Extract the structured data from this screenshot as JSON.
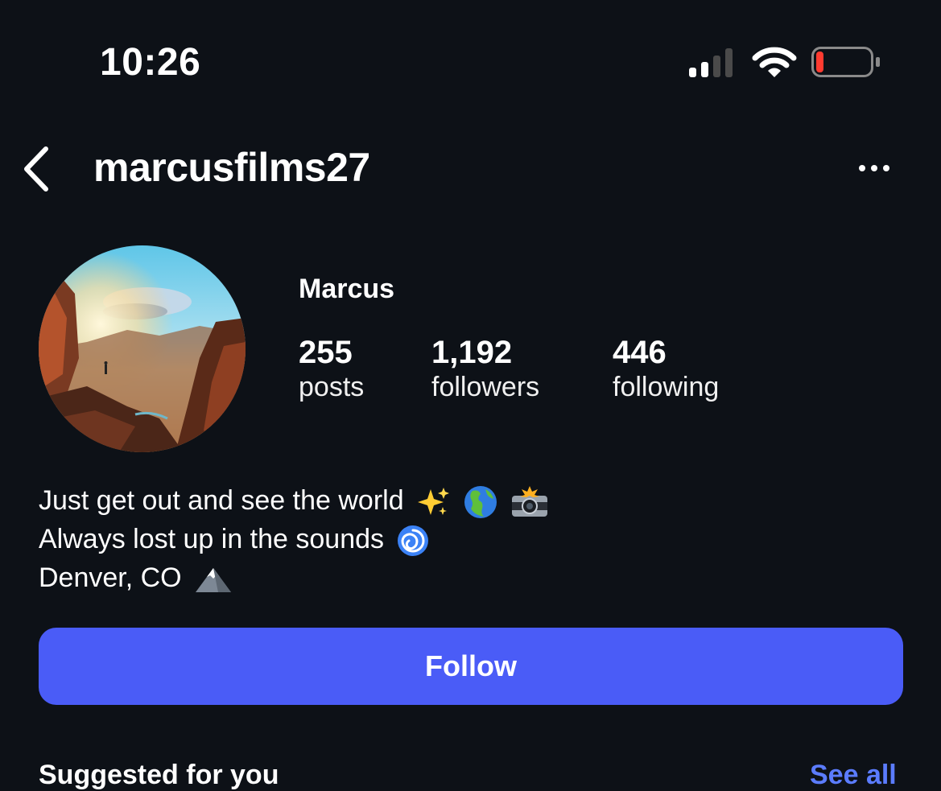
{
  "status_bar": {
    "time": "10:26",
    "signal_icon": "cellular-signal-icon",
    "wifi_icon": "wifi-icon",
    "battery_icon": "battery-icon",
    "battery_level": 0.12,
    "battery_color": "#ff3b30"
  },
  "nav": {
    "back_icon": "chevron-left-icon",
    "username": "marcusfilms27",
    "more_icon": "more-horizontal-icon"
  },
  "profile": {
    "display_name": "Marcus",
    "stats": [
      {
        "value": "255",
        "label": "posts"
      },
      {
        "value": "1,192",
        "label": "followers"
      },
      {
        "value": "446",
        "label": "following"
      }
    ],
    "bio": [
      {
        "text": "Just get out and see the world",
        "emoji": [
          "sparkles-icon",
          "globe-americas-icon",
          "camera-flash-icon"
        ]
      },
      {
        "text": "Always lost up in the sounds",
        "emoji": [
          "cyclone-icon"
        ]
      },
      {
        "text": "Denver, CO",
        "emoji": [
          "snow-capped-mountain-icon"
        ]
      }
    ]
  },
  "actions": {
    "follow_label": "Follow",
    "follow_color": "#4a5cf7"
  },
  "suggested": {
    "label": "Suggested for you",
    "see_all": "See all"
  },
  "colors": {
    "background": "#0d1117",
    "text": "#ffffff",
    "link": "#5b7cff"
  }
}
